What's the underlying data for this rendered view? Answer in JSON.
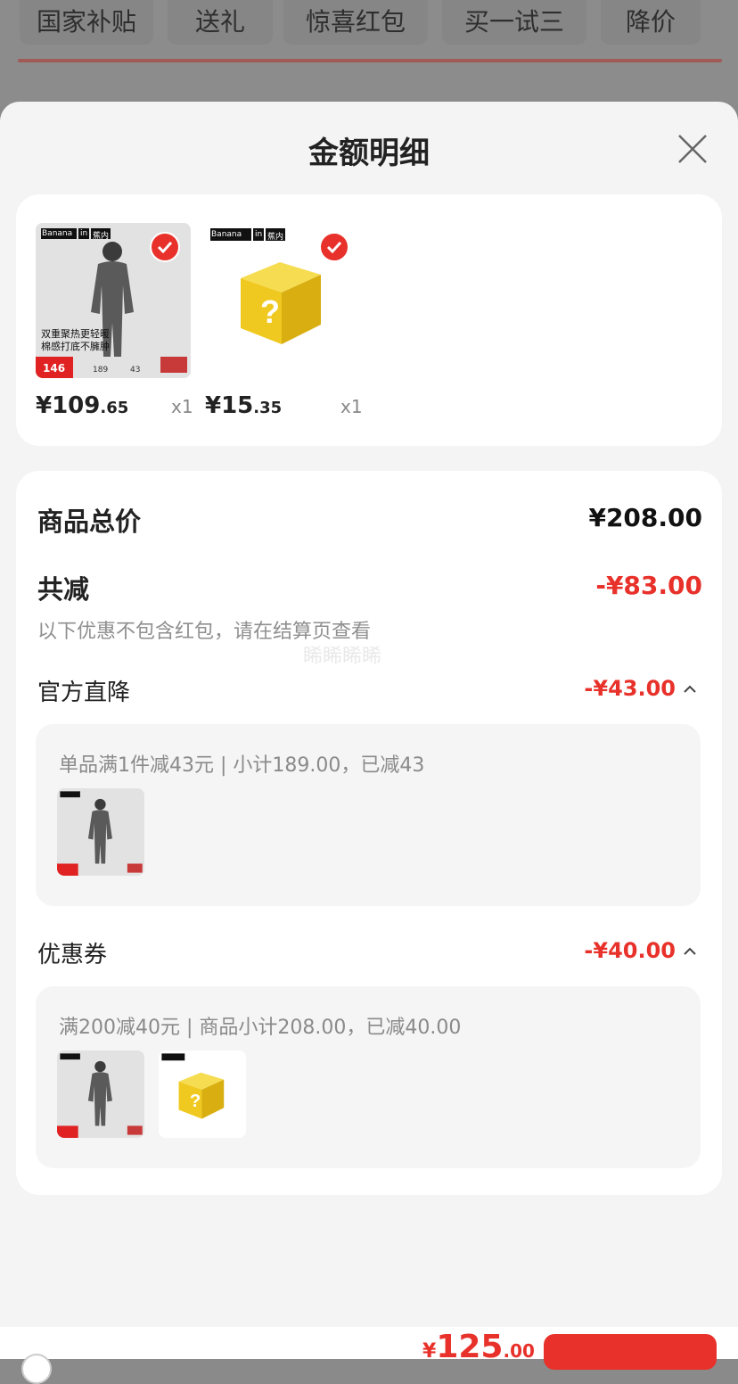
{
  "tabs": [
    "国家补贴",
    "送礼",
    "惊喜红包",
    "买一试三",
    "降价"
  ],
  "sheet": {
    "title": "金额明细"
  },
  "products": [
    {
      "price_int": "¥109",
      "price_dec": ".65",
      "qty": "x1",
      "image_text": {
        "brand": "Banana",
        "brand2": "in",
        "brand3": "蕉内",
        "tagline1": "双重聚热更轻暖",
        "tagline2": "棉感打底不臃肿",
        "badge": "146",
        "stat1": "189",
        "stat2": "43"
      }
    },
    {
      "price_int": "¥15",
      "price_dec": ".35",
      "qty": "x1",
      "image_text": {
        "brand": "Banana",
        "brand2": "in",
        "brand3": "蕉内"
      }
    }
  ],
  "summary": {
    "total_label": "商品总价",
    "total_value": "¥208.00",
    "reduce_label": "共减",
    "reduce_value": "-¥83.00",
    "reduce_note": "以下优惠不包含红包，请在结算页查看",
    "watermark": "睎睎睎睎",
    "direct_label": "官方直降",
    "direct_value": "-¥43.00",
    "direct_detail": "单品满1件减43元 | 小计189.00，已减43",
    "coupon_label": "优惠券",
    "coupon_value": "-¥40.00",
    "coupon_detail": "满200减40元 | 商品小计208.00，已减40.00"
  },
  "bottom": {
    "total_cur": "¥",
    "total_int": "125",
    "total_dec": ".00"
  },
  "colors": {
    "accent": "#e8312a",
    "sheet_bg": "#f4f4f4",
    "card_bg": "#ffffff",
    "overlay": "#8a8a8a"
  }
}
